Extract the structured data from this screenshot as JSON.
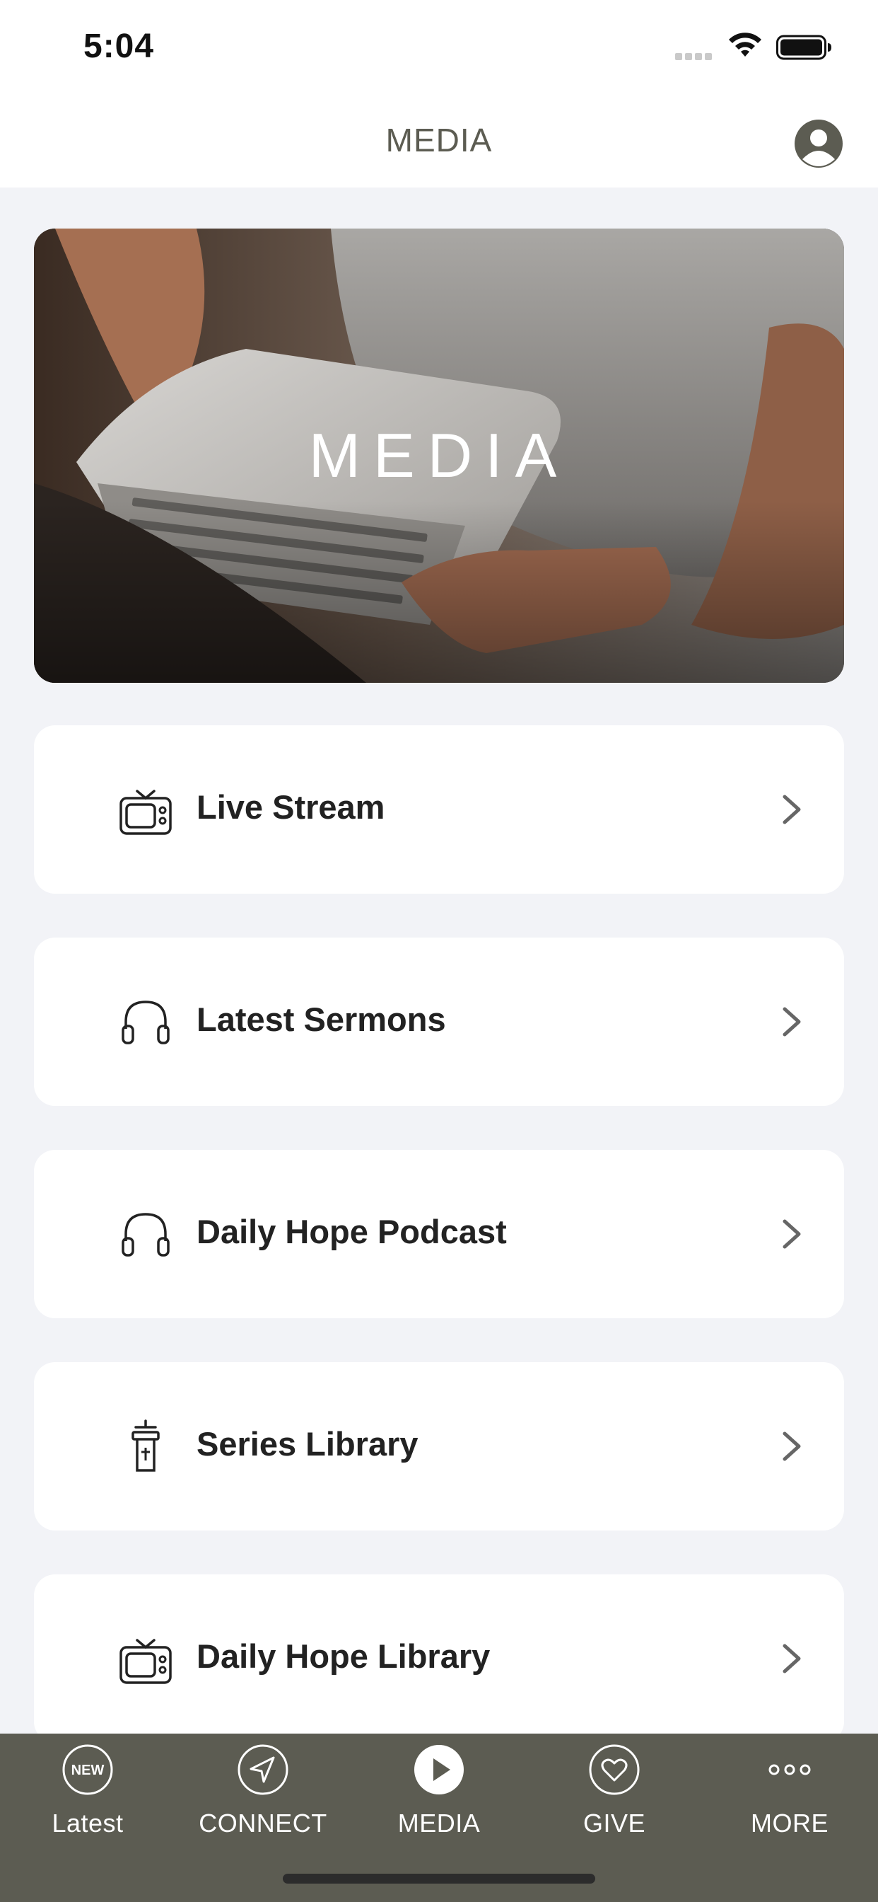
{
  "status_bar": {
    "time": "5:04",
    "icons": [
      "signal-icon",
      "wifi-icon",
      "battery-icon"
    ]
  },
  "header": {
    "title": "MEDIA",
    "profile_icon": "profile-icon"
  },
  "hero": {
    "title": "MEDIA"
  },
  "menu": {
    "items": [
      {
        "label": "Live Stream",
        "icon": "tv-icon"
      },
      {
        "label": "Latest Sermons",
        "icon": "headphones-icon"
      },
      {
        "label": "Daily Hope Podcast",
        "icon": "headphones-icon"
      },
      {
        "label": "Series Library",
        "icon": "pulpit-icon"
      },
      {
        "label": "Daily Hope Library",
        "icon": "tv-icon"
      }
    ]
  },
  "tab_bar": {
    "active": "MEDIA",
    "tabs": [
      {
        "label": "Latest",
        "icon": "new-badge-icon",
        "badge": "NEW"
      },
      {
        "label": "CONNECT",
        "icon": "navigation-arrow-icon"
      },
      {
        "label": "MEDIA",
        "icon": "play-icon"
      },
      {
        "label": "GIVE",
        "icon": "heart-icon"
      },
      {
        "label": "MORE",
        "icon": "more-dots-icon"
      }
    ]
  },
  "colors": {
    "tab_bar_bg": "#5c5c52",
    "page_bg": "#f2f3f7",
    "header_title": "#5c5c52"
  }
}
